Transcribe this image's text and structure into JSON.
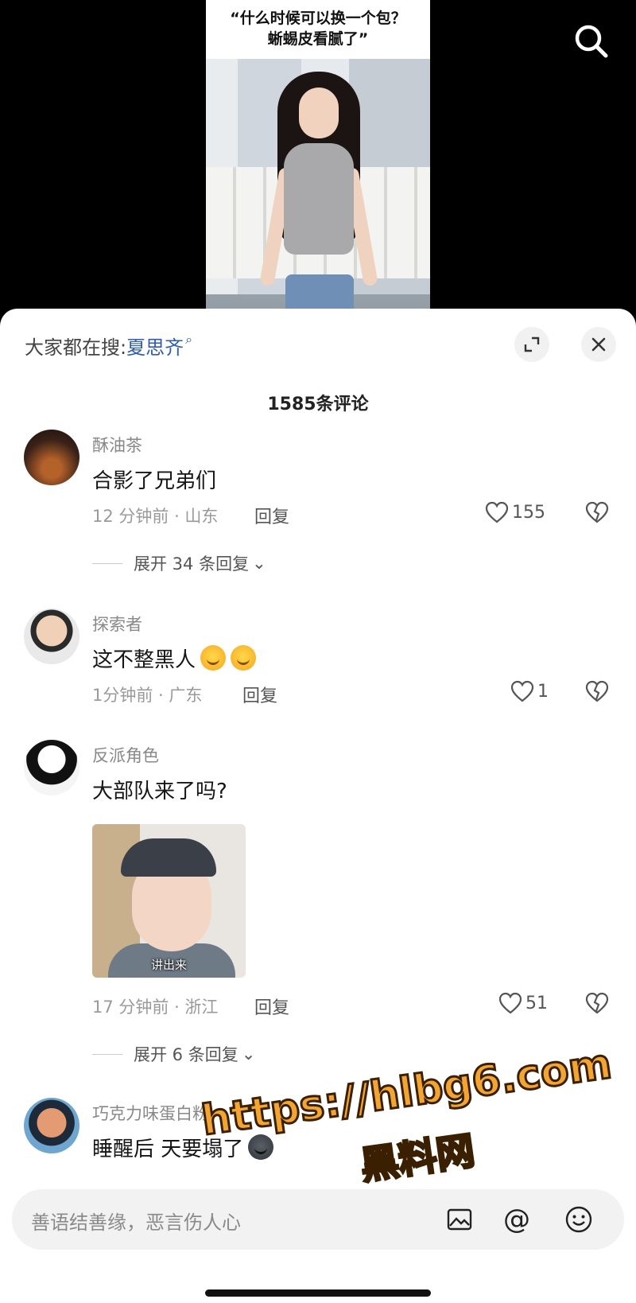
{
  "video": {
    "caption_line1": "“什么时候可以换一个包？",
    "caption_line2": "蜥蜴皮看腻了”",
    "search_icon": "search-icon"
  },
  "sheet": {
    "trend_prefix": "大家都在搜:",
    "trend_keyword": "夏思齐",
    "trend_icon": "search-icon",
    "comment_count": "1585条评论"
  },
  "comments": [
    {
      "user": "酥油茶",
      "text": "合影了兄弟们",
      "time_location": "12 分钟前 · 山东",
      "reply": "回复",
      "likes": "155",
      "expand": "展开 34 条回复"
    },
    {
      "user": "探索者",
      "text": "这不整黑人",
      "time_location": "1分钟前 · 广东",
      "reply": "回复",
      "likes": "1"
    },
    {
      "user": "反派角色",
      "text": "大部队来了吗?",
      "image_subtitle": "讲出来",
      "time_location": "17 分钟前 · 浙江",
      "reply": "回复",
      "likes": "51",
      "expand": "展开 6 条回复"
    },
    {
      "user": "巧克力味蛋白粉",
      "text": "睡醒后 天要塌了"
    }
  ],
  "watermark": {
    "line1": "https://hlbg6.com",
    "line2": "黑料网"
  },
  "input": {
    "placeholder": "善语结善缘，恶言伤人心"
  },
  "colors": {
    "keyword": "#2f5da9",
    "watermark": "#f2a533"
  }
}
